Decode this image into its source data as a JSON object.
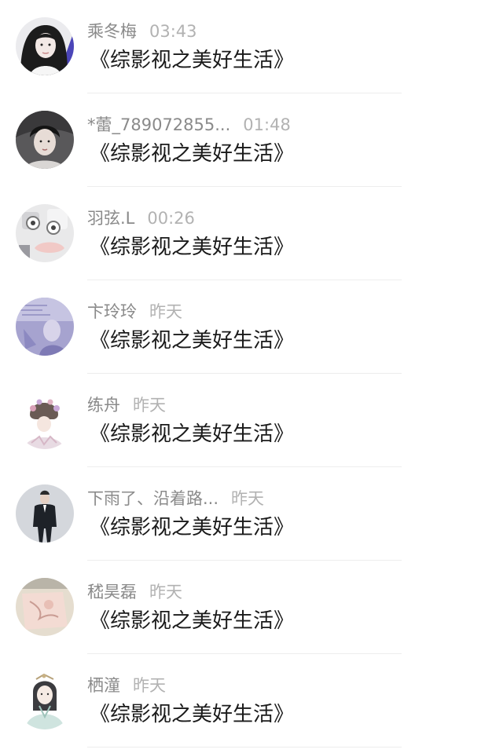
{
  "comments": [
    {
      "name": "乘冬梅",
      "time": "03:43",
      "text": "《综影视之美好生活》",
      "avatar": "girl-portrait-avatar"
    },
    {
      "name": "*蕾_789072855...",
      "time": "01:48",
      "text": "《综影视之美好生活》",
      "avatar": "boy-portrait-avatar"
    },
    {
      "name": "羽弦.L",
      "time": "00:26",
      "text": "《综影视之美好生活》",
      "avatar": "cartoon-avatar"
    },
    {
      "name": "卞玲玲",
      "time": "昨天",
      "text": "《综影视之美好生活》",
      "avatar": "purple-photo-avatar"
    },
    {
      "name": "练舟",
      "time": "昨天",
      "text": "《综影视之美好生活》",
      "avatar": "flower-hair-girl-avatar"
    },
    {
      "name": "下雨了、沿着路...",
      "time": "昨天",
      "text": "《综影视之美好生活》",
      "avatar": "suit-man-avatar"
    },
    {
      "name": "嵇昊磊",
      "time": "昨天",
      "text": "《综影视之美好生活》",
      "avatar": "pink-paper-avatar"
    },
    {
      "name": "栖潼",
      "time": "昨天",
      "text": "《综影视之美好生活》",
      "avatar": "ancient-costume-girl-avatar"
    }
  ],
  "colors": {
    "name": "#8a8a8a",
    "time": "#b2b2b2",
    "text": "#1a1a1a",
    "divider": "#ededed"
  }
}
